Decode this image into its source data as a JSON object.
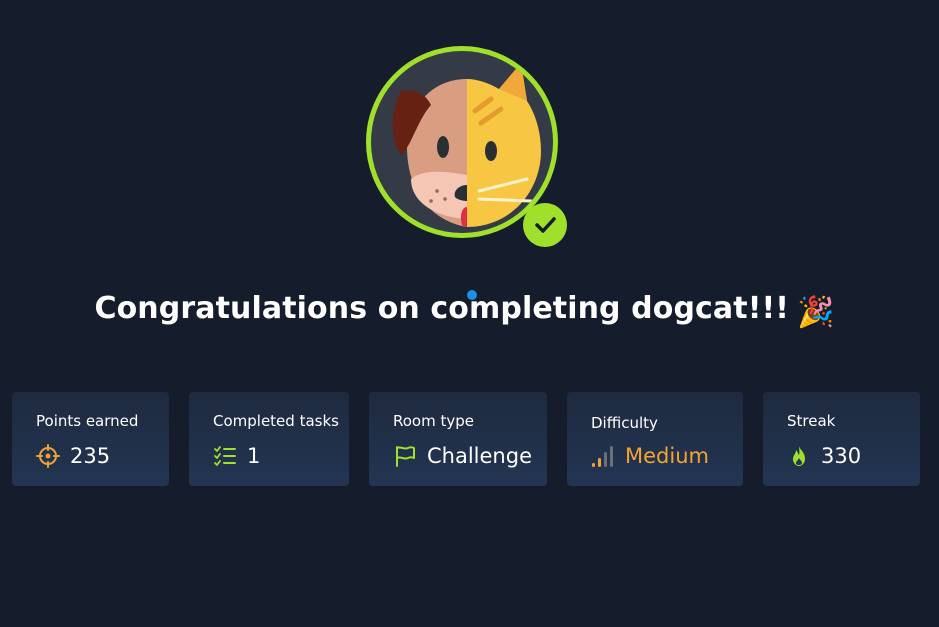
{
  "congrats": {
    "title": "Congratulations on completing dogcat!!!",
    "emoji": "🎉"
  },
  "stats": [
    {
      "label": "Points earned",
      "value": "235",
      "icon": "crosshair-icon"
    },
    {
      "label": "Completed tasks",
      "value": "1",
      "icon": "checklist-icon"
    },
    {
      "label": "Room type",
      "value": "Challenge",
      "icon": "flag-icon"
    },
    {
      "label": "Difficulty",
      "value": "Medium",
      "icon": "signal-bars-icon"
    },
    {
      "label": "Streak",
      "value": "330",
      "icon": "flame-icon"
    }
  ],
  "colors": {
    "background": "#151c2b",
    "accent": "#9fe02a",
    "difficulty_medium": "#f5a234",
    "points_icon": "#f5a234"
  }
}
